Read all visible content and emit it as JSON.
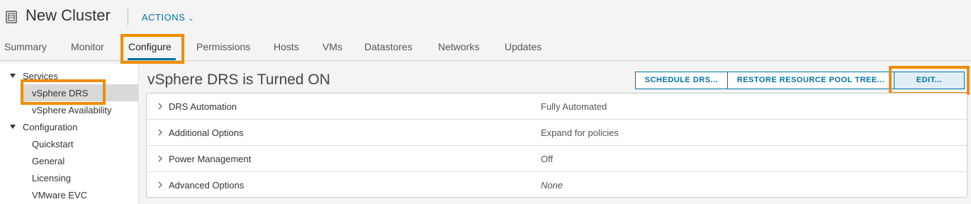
{
  "header": {
    "title": "New Cluster",
    "actions_label": "ACTIONS",
    "icon": "cluster-icon"
  },
  "tabs": [
    {
      "label": "Summary"
    },
    {
      "label": "Monitor"
    },
    {
      "label": "Configure",
      "active": true
    },
    {
      "label": "Permissions"
    },
    {
      "label": "Hosts"
    },
    {
      "label": "VMs"
    },
    {
      "label": "Datastores"
    },
    {
      "label": "Networks"
    },
    {
      "label": "Updates"
    }
  ],
  "sidebar": {
    "groups": [
      {
        "label": "Services",
        "items": [
          {
            "label": "vSphere DRS",
            "selected": true
          },
          {
            "label": "vSphere Availability"
          }
        ]
      },
      {
        "label": "Configuration",
        "items": [
          {
            "label": "Quickstart"
          },
          {
            "label": "General"
          },
          {
            "label": "Licensing"
          },
          {
            "label": "VMware EVC"
          }
        ]
      }
    ]
  },
  "main": {
    "title": "vSphere DRS is Turned ON",
    "buttons": {
      "schedule": "SCHEDULE DRS...",
      "restore": "RESTORE RESOURCE POOL TREE...",
      "edit": "EDIT..."
    },
    "rows": [
      {
        "label": "DRS Automation",
        "value": "Fully Automated"
      },
      {
        "label": "Additional Options",
        "value": "Expand for policies"
      },
      {
        "label": "Power Management",
        "value": "Off"
      },
      {
        "label": "Advanced Options",
        "value": "None"
      }
    ]
  },
  "colors": {
    "accent": "#0072a3",
    "highlight": "#f28c00"
  }
}
